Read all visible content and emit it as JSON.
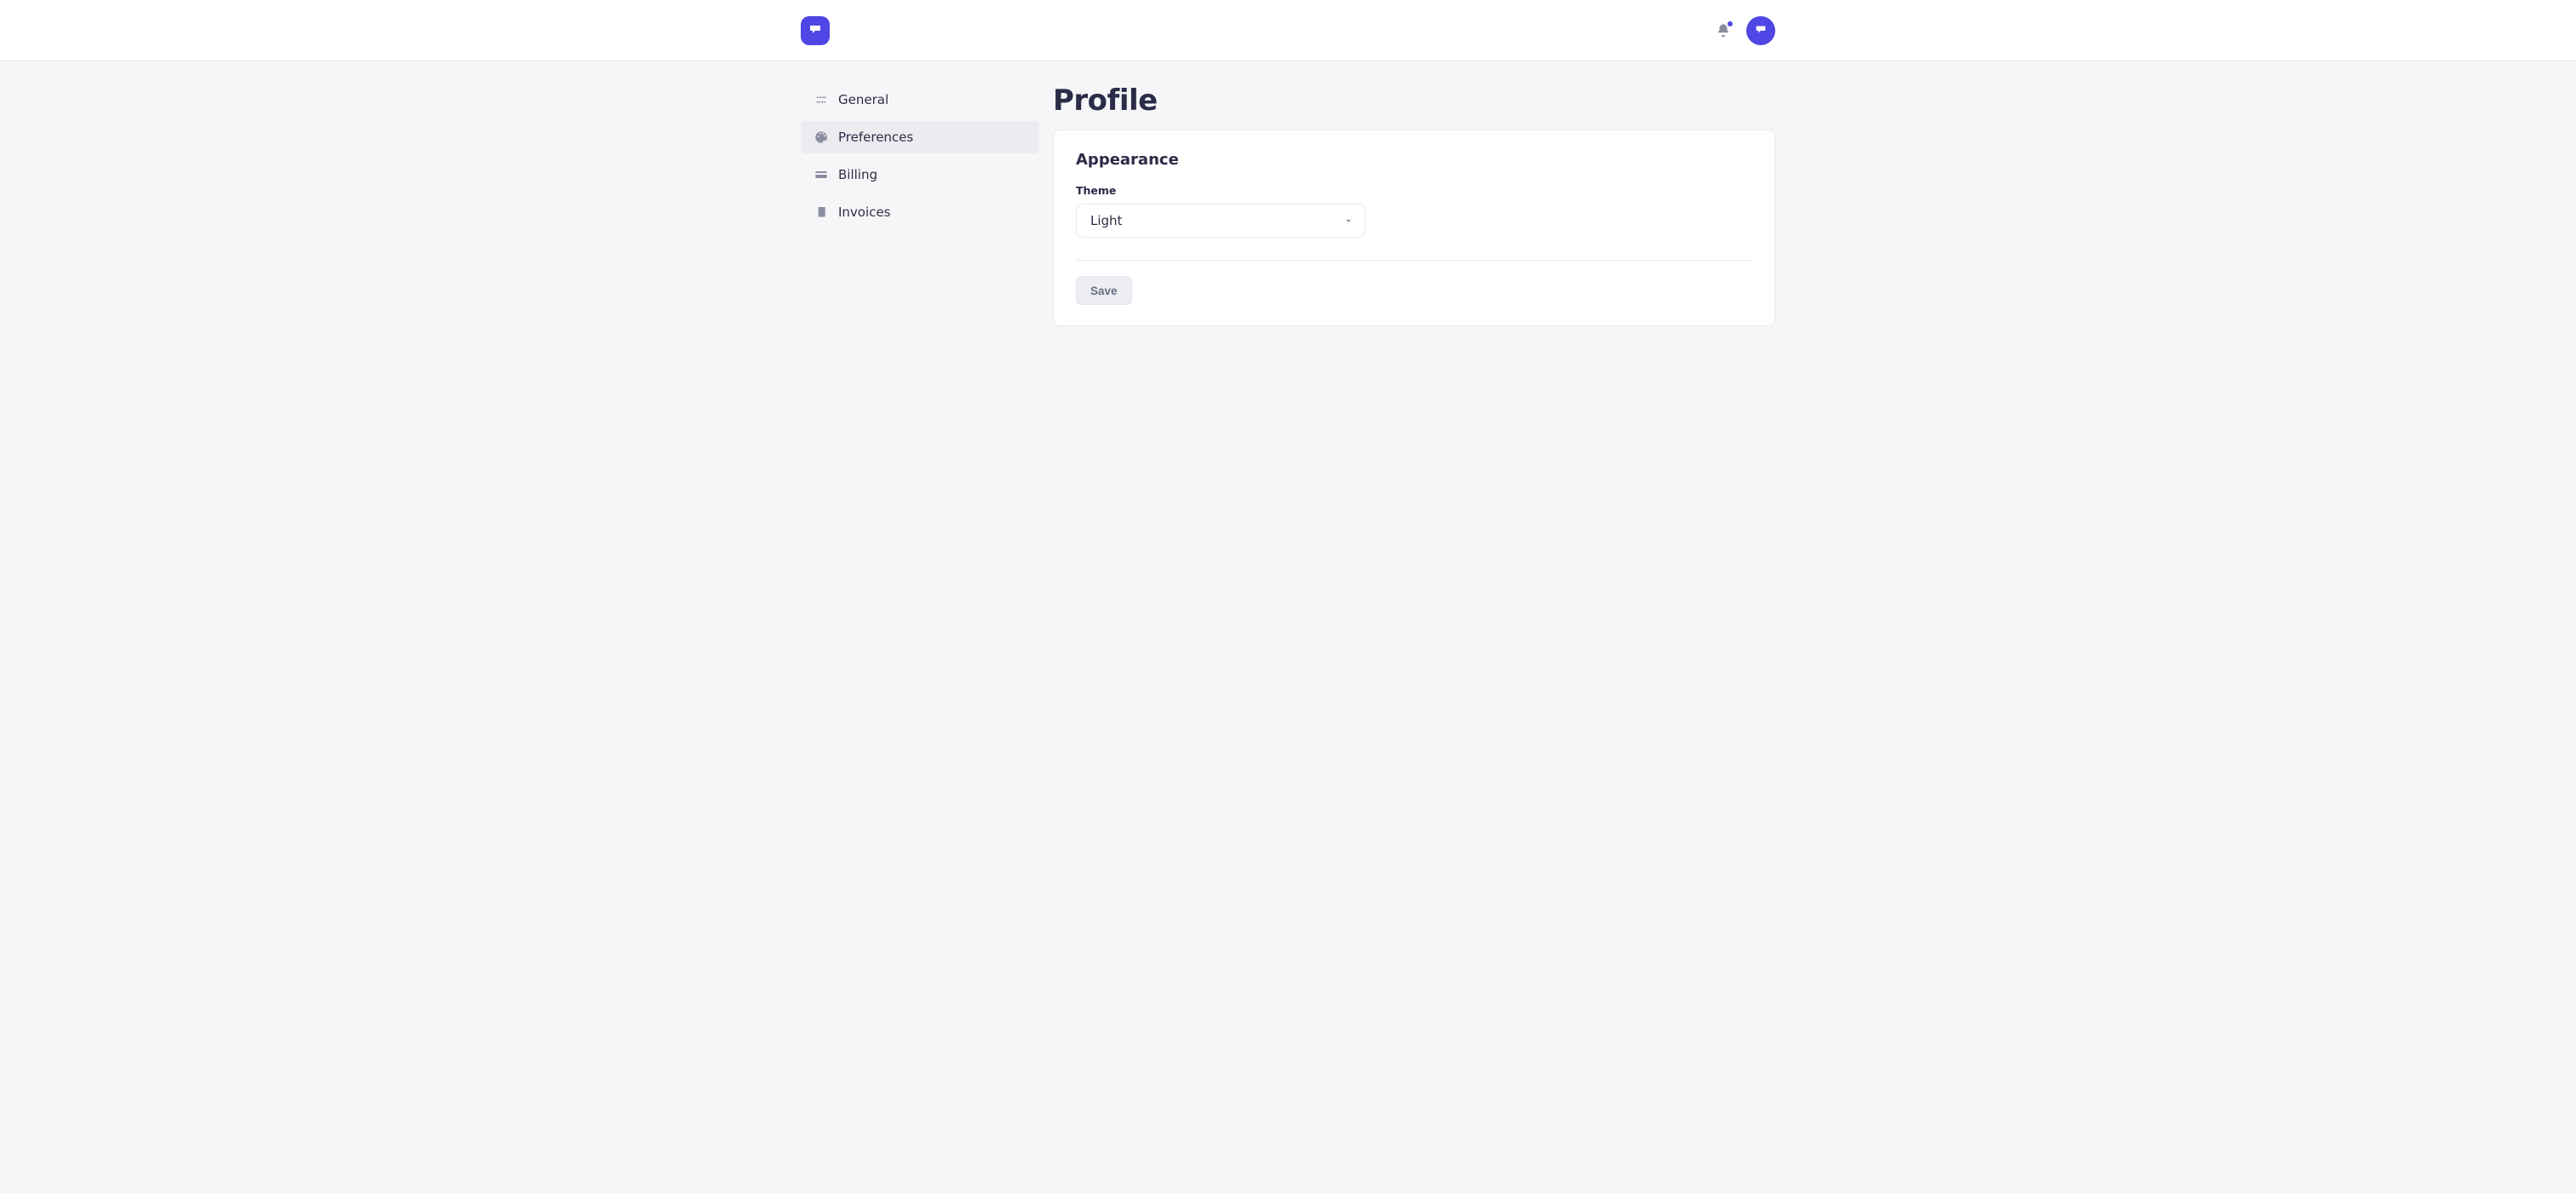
{
  "sidebar": {
    "items": [
      {
        "id": "general",
        "label": "General",
        "icon": "sliders-icon",
        "active": false
      },
      {
        "id": "preferences",
        "label": "Preferences",
        "icon": "palette-icon",
        "active": true
      },
      {
        "id": "billing",
        "label": "Billing",
        "icon": "card-icon",
        "active": false
      },
      {
        "id": "invoices",
        "label": "Invoices",
        "icon": "receipt-icon",
        "active": false
      }
    ]
  },
  "header": {
    "notifications_unread": true
  },
  "page": {
    "title": "Profile"
  },
  "appearance": {
    "section_title": "Appearance",
    "theme_label": "Theme",
    "theme_value": "Light",
    "save_label": "Save"
  },
  "colors": {
    "brand": "#4f46e5"
  }
}
